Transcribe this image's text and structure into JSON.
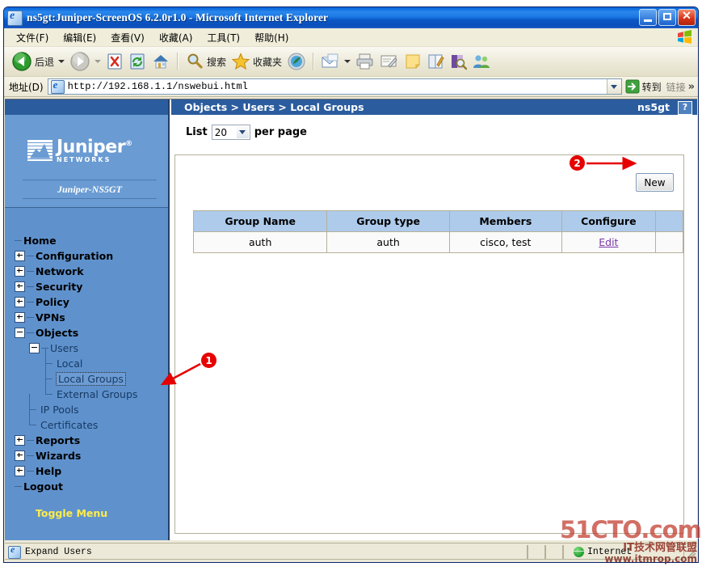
{
  "window": {
    "title": "ns5gt:Juniper-ScreenOS 6.2.0r1.0 - Microsoft Internet Explorer",
    "icon": "ie-document-icon",
    "buttons": {
      "minimize": "minimize",
      "maximize": "maximize",
      "close": "close"
    }
  },
  "menubar": {
    "items": [
      {
        "label": "文件(F)",
        "name": "menu-file"
      },
      {
        "label": "编辑(E)",
        "name": "menu-edit"
      },
      {
        "label": "查看(V)",
        "name": "menu-view"
      },
      {
        "label": "收藏(A)",
        "name": "menu-favorites"
      },
      {
        "label": "工具(T)",
        "name": "menu-tools"
      },
      {
        "label": "帮助(H)",
        "name": "menu-help"
      }
    ]
  },
  "toolbar": {
    "back_label": "后退",
    "search_label": "搜索",
    "favorites_label": "收藏夹"
  },
  "address": {
    "label": "地址(D)",
    "url": "http://192.168.1.1/nswebui.html",
    "go_label": "转到",
    "links_label": "链接",
    "links_chevron": "»"
  },
  "nav": {
    "brand": {
      "name": "Juniper",
      "registered": "®",
      "tagline": "NETWORKS",
      "model": "Juniper-NS5GT"
    },
    "tree": [
      {
        "label": "Home",
        "level": 1,
        "toggle": "none",
        "name": "nav-home"
      },
      {
        "label": "Configuration",
        "level": 1,
        "toggle": "plus",
        "name": "nav-configuration"
      },
      {
        "label": "Network",
        "level": 1,
        "toggle": "plus",
        "name": "nav-network"
      },
      {
        "label": "Security",
        "level": 1,
        "toggle": "plus",
        "name": "nav-security"
      },
      {
        "label": "Policy",
        "level": 1,
        "toggle": "plus",
        "name": "nav-policy"
      },
      {
        "label": "VPNs",
        "level": 1,
        "toggle": "plus",
        "name": "nav-vpns"
      },
      {
        "label": "Objects",
        "level": 1,
        "toggle": "minus",
        "name": "nav-objects"
      },
      {
        "label": "Users",
        "level": 2,
        "toggle": "minus",
        "name": "nav-users"
      },
      {
        "label": "Local",
        "level": 3,
        "toggle": "none",
        "name": "nav-local"
      },
      {
        "label": "Local Groups",
        "level": 3,
        "toggle": "none",
        "name": "nav-local-groups",
        "selected": true
      },
      {
        "label": "External Groups",
        "level": 3,
        "toggle": "none",
        "name": "nav-external-groups"
      },
      {
        "label": "IP Pools",
        "level": 2,
        "toggle": "none",
        "name": "nav-ip-pools"
      },
      {
        "label": "Certificates",
        "level": 2,
        "toggle": "none",
        "name": "nav-certificates"
      },
      {
        "label": "Reports",
        "level": 1,
        "toggle": "plus",
        "name": "nav-reports"
      },
      {
        "label": "Wizards",
        "level": 1,
        "toggle": "plus",
        "name": "nav-wizards"
      },
      {
        "label": "Help",
        "level": 1,
        "toggle": "plus",
        "name": "nav-help"
      },
      {
        "label": "Logout",
        "level": 1,
        "toggle": "none",
        "name": "nav-logout"
      }
    ],
    "toggle_menu": "Toggle Menu"
  },
  "content": {
    "breadcrumb": "Objects > Users > Local Groups",
    "device": "ns5gt",
    "help_button": "?",
    "list_prefix": "List",
    "per_page_value": "20",
    "per_page_suffix": "per page",
    "new_button": "New",
    "table": {
      "headers": [
        "Group Name",
        "Group type",
        "Members",
        "Configure",
        ""
      ],
      "rows": [
        {
          "group_name": "auth",
          "group_type": "auth",
          "members": "cisco, test",
          "configure": "Edit",
          "extra": ""
        }
      ]
    }
  },
  "annotations": {
    "marker_1": "❶",
    "marker_1_digit": "1",
    "marker_2_digit": "2",
    "color": "#e60000"
  },
  "statusbar": {
    "text": "Expand Users",
    "zone": "Internet"
  },
  "watermark": {
    "main": "51CTO.com",
    "sub1": "IT技术网管联盟",
    "sub2": "www.itmrop.com"
  }
}
